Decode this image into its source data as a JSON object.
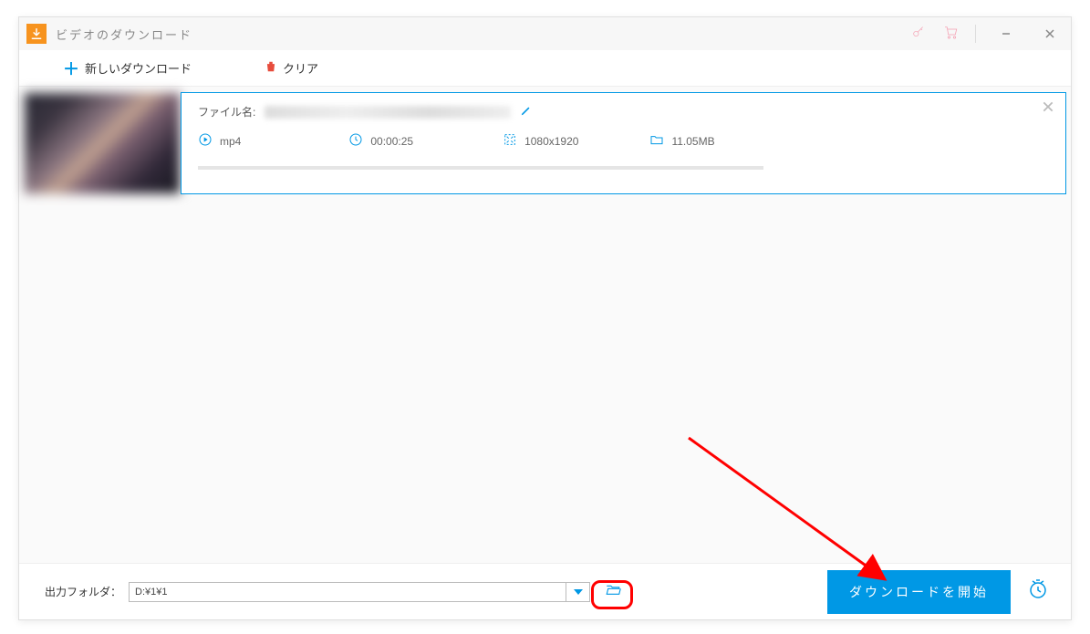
{
  "titlebar": {
    "title": "ビデオのダウンロード"
  },
  "toolbar": {
    "new_download_label": "新しいダウンロード",
    "clear_label": "クリア"
  },
  "item": {
    "filename_label": "ファイル名:",
    "format": "mp4",
    "duration": "00:00:25",
    "resolution": "1080x1920",
    "filesize": "11.05MB"
  },
  "footer": {
    "output_folder_label": "出力フォルダ：",
    "output_folder_value": "D:¥1¥1",
    "start_button_label": "ダウンロードを開始"
  }
}
